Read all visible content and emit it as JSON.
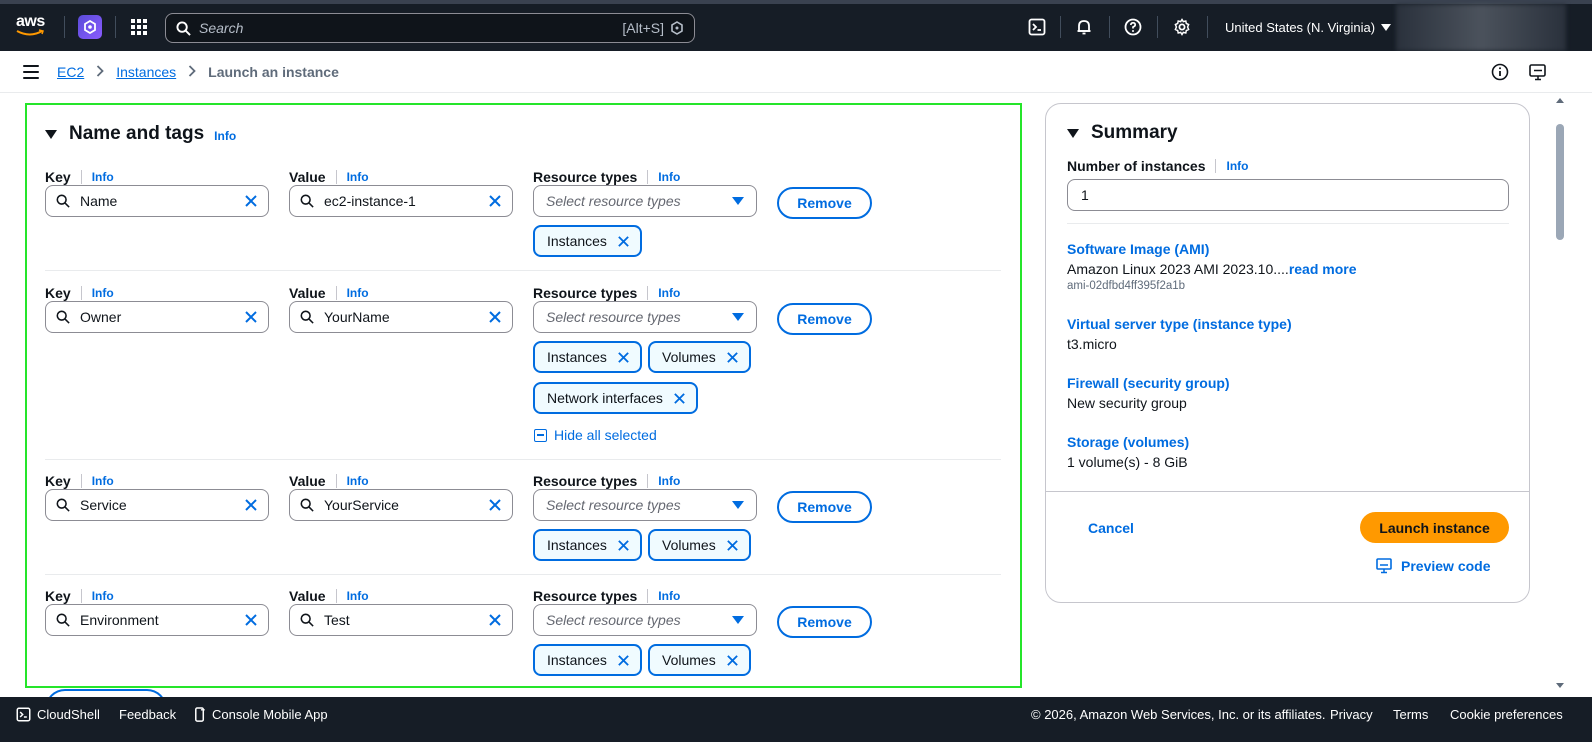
{
  "topnav": {
    "logo_text": "aws",
    "search_placeholder": "Search",
    "search_shortcut": "[Alt+S]",
    "region": "United States (N. Virginia)"
  },
  "breadcrumb": {
    "items": [
      "EC2",
      "Instances"
    ],
    "current": "Launch an instance"
  },
  "name_and_tags": {
    "title": "Name and tags",
    "info": "Info",
    "key_label": "Key",
    "value_label": "Value",
    "resource_label": "Resource types",
    "resource_placeholder": "Select resource types",
    "remove_label": "Remove",
    "hide_all_label": "Hide all selected",
    "rows": [
      {
        "key": "Name",
        "value": "ec2-instance-1",
        "tokens": [
          "Instances"
        ]
      },
      {
        "key": "Owner",
        "value": "YourName",
        "tokens": [
          "Instances",
          "Volumes",
          "Network interfaces"
        ]
      },
      {
        "key": "Service",
        "value": "YourService",
        "tokens": [
          "Instances",
          "Volumes"
        ]
      },
      {
        "key": "Environment",
        "value": "Test",
        "tokens": [
          "Instances",
          "Volumes"
        ]
      }
    ]
  },
  "summary": {
    "title": "Summary",
    "num_instances_label": "Number of instances",
    "info": "Info",
    "num_instances": "1",
    "ami_label": "Software Image (AMI)",
    "ami_value": "Amazon Linux 2023 AMI 2023.10....",
    "ami_read_more": "read more",
    "ami_id": "ami-02dfbd4ff395f2a1b",
    "instance_type_label": "Virtual server type (instance type)",
    "instance_type_value": "t3.micro",
    "firewall_label": "Firewall (security group)",
    "firewall_value": "New security group",
    "storage_label": "Storage (volumes)",
    "storage_value": "1 volume(s) - 8 GiB",
    "cancel_label": "Cancel",
    "launch_label": "Launch instance",
    "preview_label": "Preview code"
  },
  "footer": {
    "cloudshell": "CloudShell",
    "feedback": "Feedback",
    "mobile_app": "Console Mobile App",
    "copyright": "© 2026, Amazon Web Services, Inc. or its affiliates.",
    "privacy": "Privacy",
    "terms": "Terms",
    "cookie": "Cookie preferences"
  },
  "colors": {
    "nav_bg": "#161d26",
    "link": "#006ce0",
    "launch_button": "#ff9900",
    "highlight_border": "#25e52a"
  }
}
